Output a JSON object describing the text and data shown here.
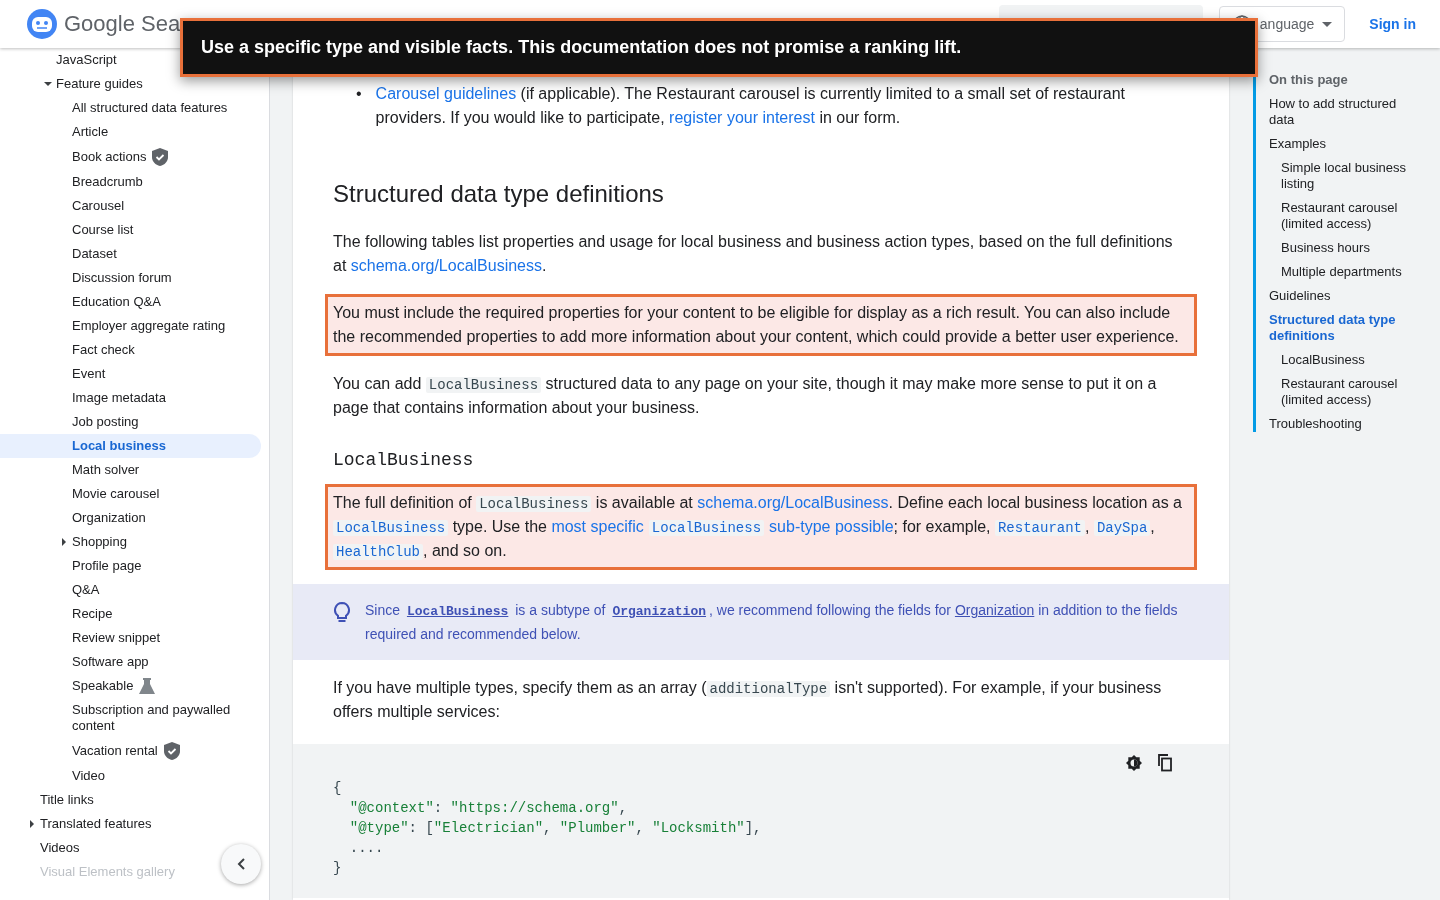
{
  "banner": {
    "text": "Use a specific type and visible facts. This documentation does not promise a ranking lift."
  },
  "header": {
    "site_name": "Google Sea",
    "language_button": "anguage",
    "sign_in": "Sign in"
  },
  "sidebar": {
    "items": [
      {
        "kind": "group",
        "children": [
          {
            "kind": "page",
            "label": "JavaScript",
            "selected": false
          },
          {
            "kind": "page",
            "label": "Feature guides",
            "selected": false,
            "expanded": true,
            "children": [
              {
                "kind": "page",
                "label": "All structured data features",
                "selected": false
              },
              {
                "kind": "page",
                "label": "Article",
                "selected": false
              },
              {
                "kind": "verified",
                "label": "Book actions",
                "selected": false
              },
              {
                "kind": "page",
                "label": "Breadcrumb",
                "selected": false
              },
              {
                "kind": "page",
                "label": "Carousel",
                "selected": false
              },
              {
                "kind": "page",
                "label": "Course list",
                "selected": false
              },
              {
                "kind": "page",
                "label": "Dataset",
                "selected": false
              },
              {
                "kind": "page",
                "label": "Discussion forum",
                "selected": false
              },
              {
                "kind": "page",
                "label": "Education Q&A",
                "selected": false
              },
              {
                "kind": "page",
                "label": "Employer aggregate rating",
                "selected": false
              },
              {
                "kind": "page",
                "label": "Fact check",
                "selected": false
              },
              {
                "kind": "page",
                "label": "Event",
                "selected": false
              },
              {
                "kind": "page",
                "label": "Image metadata",
                "selected": false
              },
              {
                "kind": "page",
                "label": "Job posting",
                "selected": false
              },
              {
                "kind": "page",
                "label": "Local business",
                "selected": true
              },
              {
                "kind": "page",
                "label": "Math solver",
                "selected": false
              },
              {
                "kind": "page",
                "label": "Movie carousel",
                "selected": false
              },
              {
                "kind": "page",
                "label": "Organization",
                "selected": false
              },
              {
                "kind": "page",
                "label": "Shopping",
                "selected": false,
                "expanded": false
              },
              {
                "kind": "page",
                "label": "Profile page",
                "selected": false
              },
              {
                "kind": "page",
                "label": "Q&A",
                "selected": false
              },
              {
                "kind": "page",
                "label": "Recipe",
                "selected": false
              },
              {
                "kind": "page",
                "label": "Review snippet",
                "selected": false
              },
              {
                "kind": "page",
                "label": "Software app",
                "selected": false
              },
              {
                "kind": "beta",
                "label": "Speakable",
                "selected": false
              },
              {
                "kind": "page",
                "label": "Subscription and paywalled content",
                "selected": false
              },
              {
                "kind": "verified",
                "label": "Vacation rental",
                "selected": false
              },
              {
                "kind": "page",
                "label": "Video",
                "selected": false
              }
            ]
          }
        ]
      },
      {
        "kind": "page",
        "label": "Title links",
        "selected": false
      },
      {
        "kind": "page",
        "label": "Translated features",
        "selected": false,
        "expanded": false
      },
      {
        "kind": "page",
        "label": "Videos",
        "selected": false
      },
      {
        "kind": "page",
        "label": "Visual Elements gallery",
        "selected": false
      }
    ]
  },
  "article": {
    "blocks": [
      {
        "kind": "bullet",
        "marker": "•",
        "highlighted": false,
        "segments": [
          {
            "kind": "link",
            "text": "Carousel guidelines"
          },
          {
            "kind": "text",
            "text": " (if applicable). The Restaurant carousel is currently limited to a small set of restaurant providers. If you would like to participate, "
          },
          {
            "kind": "link",
            "text": "register your interest"
          },
          {
            "kind": "text",
            "text": " in our form."
          }
        ]
      },
      {
        "kind": "heading",
        "text": "Structured data type definitions"
      },
      {
        "kind": "paragraph",
        "highlighted": false,
        "segments": [
          {
            "kind": "text",
            "text": "The following tables list properties and usage for local business and business action types, based on the full definitions at "
          },
          {
            "kind": "link",
            "text": "schema.org/LocalBusiness"
          },
          {
            "kind": "text",
            "text": "."
          }
        ]
      },
      {
        "kind": "paragraph",
        "highlighted": true,
        "segments": [
          {
            "kind": "text",
            "text": "You must include the required properties for your content to be eligible for display as a rich result. You can also include the recommended properties to add more information about your content, which could provide a better user experience."
          }
        ]
      },
      {
        "kind": "paragraph",
        "highlighted": false,
        "segments": [
          {
            "kind": "text",
            "text": "You can add "
          },
          {
            "kind": "code",
            "text": "LocalBusiness"
          },
          {
            "kind": "text",
            "text": " structured data to any page on your site, though it may make more sense to put it on a page that contains information about your business."
          }
        ]
      },
      {
        "kind": "code-heading",
        "text": "LocalBusiness"
      },
      {
        "kind": "paragraph",
        "highlighted": true,
        "segments": [
          {
            "kind": "text",
            "text": "The full definition of "
          },
          {
            "kind": "code",
            "text": "LocalBusiness"
          },
          {
            "kind": "text",
            "text": " is available at "
          },
          {
            "kind": "link",
            "text": "schema.org/LocalBusiness"
          },
          {
            "kind": "text",
            "text": ". Define each local business location as a "
          },
          {
            "kind": "code-link",
            "text": "LocalBusiness"
          },
          {
            "kind": "text",
            "text": " type. Use the "
          },
          {
            "kind": "link",
            "text": "most specific"
          },
          {
            "kind": "code-link",
            "text": "LocalBusiness",
            "spaced": true
          },
          {
            "kind": "link",
            "text": "sub-type possible"
          },
          {
            "kind": "text",
            "text": "; for example, "
          },
          {
            "kind": "code-link",
            "text": "Restaurant"
          },
          {
            "kind": "text",
            "text": ", "
          },
          {
            "kind": "code-link",
            "text": "DaySpa"
          },
          {
            "kind": "text",
            "text": ", "
          },
          {
            "kind": "code-link",
            "text": "HealthClub"
          },
          {
            "kind": "text",
            "text": ", and so on."
          }
        ]
      },
      {
        "kind": "note",
        "segments": [
          {
            "kind": "text",
            "text": "Since "
          },
          {
            "kind": "code-link",
            "text": "LocalBusiness"
          },
          {
            "kind": "text",
            "text": " is a subtype of "
          },
          {
            "kind": "code-link",
            "text": "Organization"
          },
          {
            "kind": "text",
            "text": ", we recommend following the fields for "
          },
          {
            "kind": "link",
            "text": "Organization"
          },
          {
            "kind": "text",
            "text": " in addition to the fields required and recommended below."
          }
        ]
      },
      {
        "kind": "paragraph",
        "highlighted": false,
        "segments": [
          {
            "kind": "text",
            "text": "If you have multiple types, specify them as an array ("
          },
          {
            "kind": "code",
            "text": "additionalType"
          },
          {
            "kind": "text",
            "text": " isn't supported). For example, if your business offers multiple services:"
          }
        ]
      },
      {
        "kind": "code-block",
        "lines": [
          {
            "indent": false,
            "tokens": [
              {
                "kind": "punct",
                "text": "{"
              }
            ]
          },
          {
            "indent": true,
            "tokens": [
              {
                "kind": "string",
                "text": "\"@context\""
              },
              {
                "kind": "punct",
                "text": ":"
              },
              {
                "kind": "string",
                "text": "\"https://schema.org\""
              },
              {
                "kind": "punct",
                "text": ","
              }
            ]
          },
          {
            "indent": true,
            "tokens": [
              {
                "kind": "string",
                "text": "\"@type\""
              },
              {
                "kind": "punct",
                "text": ": ["
              },
              {
                "kind": "string",
                "text": "\"Electrician\""
              },
              {
                "kind": "punct",
                "text": ","
              },
              {
                "kind": "string",
                "text": "\"Plumber\""
              },
              {
                "kind": "punct",
                "text": ","
              },
              {
                "kind": "string",
                "text": "\"Locksmith\""
              },
              {
                "kind": "punct",
                "text": "],"
              }
            ]
          },
          {
            "indent": true,
            "tokens": [
              {
                "kind": "punct",
                "text": "...."
              }
            ]
          },
          {
            "indent": false,
            "tokens": [
              {
                "kind": "punct",
                "text": "}"
              }
            ]
          }
        ]
      }
    ]
  },
  "toc": {
    "title": "On this page",
    "items": [
      {
        "label": "How to add structured data",
        "selected": false
      },
      {
        "label": "Examples",
        "selected": false,
        "children": [
          {
            "label": "Simple local business listing",
            "selected": false
          },
          {
            "label": "Restaurant carousel (limited access)",
            "selected": false
          },
          {
            "label": "Business hours",
            "selected": false
          },
          {
            "label": "Multiple departments",
            "selected": false
          }
        ]
      },
      {
        "label": "Guidelines",
        "selected": false
      },
      {
        "label": "Structured data type definitions",
        "selected": true,
        "children": [
          {
            "label": "LocalBusiness",
            "selected": false
          },
          {
            "label": "Restaurant carousel (limited access)",
            "selected": false
          }
        ]
      },
      {
        "label": "Troubleshooting",
        "selected": false
      }
    ]
  }
}
